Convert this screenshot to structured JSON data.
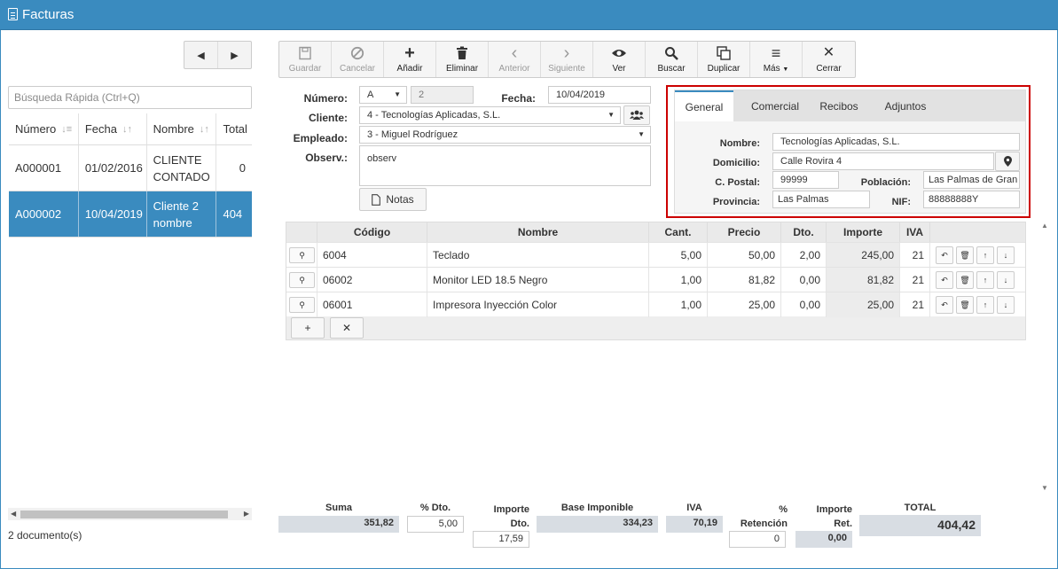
{
  "window": {
    "title": "Facturas"
  },
  "nav": {
    "prev": "◀",
    "next": "▶"
  },
  "search": {
    "placeholder": "Búsqueda Rápida (Ctrl+Q)"
  },
  "list": {
    "columns": [
      "Número",
      "Fecha",
      "Nombre",
      "Total"
    ],
    "rows": [
      {
        "numero": "A000001",
        "fecha": "01/02/2016",
        "nombre": "CLIENTE CONTADO",
        "total": "0"
      },
      {
        "numero": "A000002",
        "fecha": "10/04/2019",
        "nombre": "Cliente 2 nombre",
        "total": "404"
      }
    ],
    "count_text": "2 documento(s)"
  },
  "toolbar": {
    "guardar": "Guardar",
    "cancelar": "Cancelar",
    "anadir": "Añadir",
    "eliminar": "Eliminar",
    "anterior": "Anterior",
    "siguiente": "Siguiente",
    "ver": "Ver",
    "buscar": "Buscar",
    "duplicar": "Duplicar",
    "mas": "Más",
    "cerrar": "Cerrar"
  },
  "header": {
    "numero_label": "Número:",
    "serie": "A",
    "numero": "2",
    "fecha_label": "Fecha:",
    "fecha": "10/04/2019",
    "cliente_label": "Cliente:",
    "cliente": "4 - Tecnologías Aplicadas, S.L.",
    "empleado_label": "Empleado:",
    "empleado": "3 - Miguel Rodríguez",
    "observ_label": "Observ.:",
    "observ": "observ",
    "notas": "Notas"
  },
  "customer_panel": {
    "tabs": [
      "General",
      "Comercial",
      "Recibos",
      "Adjuntos"
    ],
    "active_tab": "General",
    "nombre_label": "Nombre:",
    "nombre": "Tecnologías Aplicadas, S.L.",
    "domicilio_label": "Domicilio:",
    "domicilio": "Calle Rovira 4",
    "cpostal_label": "C. Postal:",
    "cpostal": "99999",
    "poblacion_label": "Población:",
    "poblacion": "Las Palmas de Gran",
    "provincia_label": "Provincia:",
    "provincia": "Las Palmas",
    "nif_label": "NIF:",
    "nif": "88888888Y"
  },
  "lines": {
    "columns": [
      "Código",
      "Nombre",
      "Cant.",
      "Precio",
      "Dto.",
      "Importe",
      "IVA"
    ],
    "rows": [
      {
        "codigo": "6004",
        "nombre": "Teclado",
        "cant": "5,00",
        "precio": "50,00",
        "dto": "2,00",
        "importe": "245,00",
        "iva": "21"
      },
      {
        "codigo": "06002",
        "nombre": "Monitor LED 18.5 Negro",
        "cant": "1,00",
        "precio": "81,82",
        "dto": "0,00",
        "importe": "81,82",
        "iva": "21"
      },
      {
        "codigo": "06001",
        "nombre": "Impresora Inyección Color",
        "cant": "1,00",
        "precio": "25,00",
        "dto": "0,00",
        "importe": "25,00",
        "iva": "21"
      }
    ]
  },
  "totals": {
    "suma_label": "Suma",
    "suma": "351,82",
    "pdto_label": "% Dto.",
    "pdto": "5,00",
    "idto_label1": "Importe",
    "idto_label2": "Dto.",
    "idto": "17,59",
    "base_label": "Base Imponible",
    "base": "334,23",
    "iva_label": "IVA",
    "iva": "70,19",
    "pret_label1": "%",
    "pret_label2": "Retención",
    "pret": "0",
    "iret_label1": "Importe",
    "iret_label2": "Ret.",
    "iret": "0,00",
    "total_label": "TOTAL",
    "total": "404,42"
  },
  "colors": {
    "accent": "#3a8bbf",
    "highlight_border": "#cc0000"
  }
}
